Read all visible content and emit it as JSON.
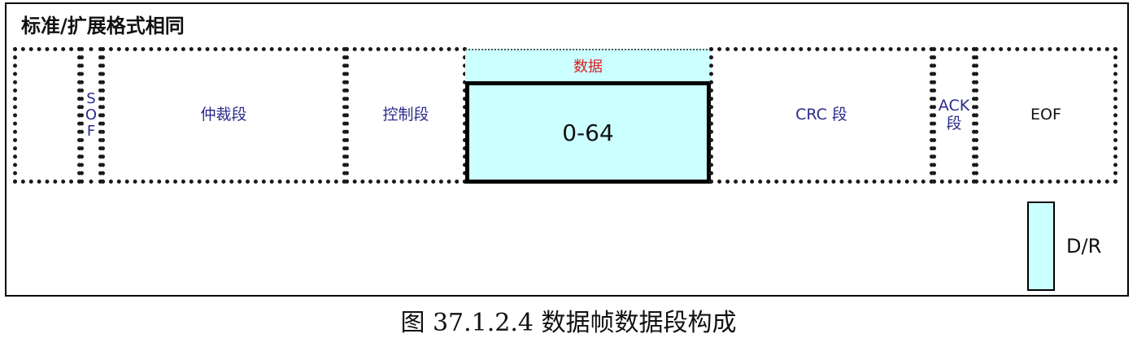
{
  "header": "标准/扩展格式相同",
  "segments": {
    "empty": "",
    "sof_letters": [
      "S",
      "O",
      "F"
    ],
    "arbitration": "仲裁段",
    "control": "控制段",
    "data_label": "数据",
    "data_value": "0-64",
    "crc": "CRC 段",
    "ack_line1": "ACK",
    "ack_line2": "段",
    "eof": "EOF"
  },
  "legend": {
    "label": "D/R"
  },
  "caption": "图 37.1.2.4 数据帧数据段构成",
  "colors": {
    "highlight": "#ccffff",
    "segment_text": "#2b2b8c",
    "data_label": "#d62020"
  }
}
